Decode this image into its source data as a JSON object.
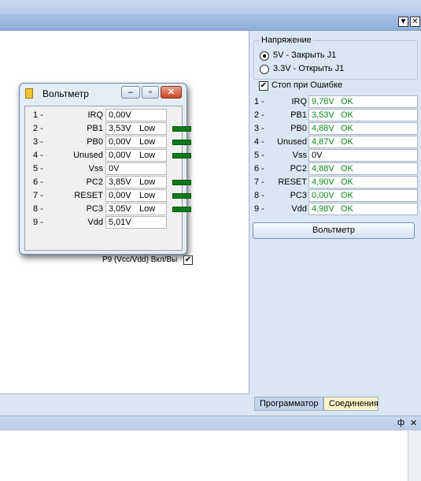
{
  "window": {
    "title_buttons": [
      "▼",
      "✕"
    ]
  },
  "voltmeter_window": {
    "title": "Вольтметр",
    "rows": [
      {
        "num": "1 -",
        "name": "IRQ",
        "value": "0,00V",
        "status": "",
        "led": false
      },
      {
        "num": "2 -",
        "name": "PB1",
        "value": "3,53V",
        "status": "Low",
        "led": true
      },
      {
        "num": "3 -",
        "name": "PB0",
        "value": "0,00V",
        "status": "Low",
        "led": true
      },
      {
        "num": "4 -",
        "name": "Unused",
        "value": "0,00V",
        "status": "Low",
        "led": true
      },
      {
        "num": "5 -",
        "name": "Vss",
        "value": "0V",
        "status": "",
        "led": false
      },
      {
        "num": "6 -",
        "name": "PC2",
        "value": "3,85V",
        "status": "Low",
        "led": true
      },
      {
        "num": "7 -",
        "name": "RESET",
        "value": "0,00V",
        "status": "Low",
        "led": true
      },
      {
        "num": "8 -",
        "name": "PC3",
        "value": "3,05V",
        "status": "Low",
        "led": true
      },
      {
        "num": "9 -",
        "name": "Vdd",
        "value": "5,01V",
        "status": "",
        "led": false
      }
    ],
    "footer_label": "P9 (Vcc/Vdd) Вкл/Вы",
    "footer_checked": true
  },
  "right_panel": {
    "voltage_group_title": "Напряжение",
    "options": [
      {
        "label": "5V - Закрыть J1",
        "selected": true
      },
      {
        "label": "3.3V - Открыть J1",
        "selected": false
      }
    ],
    "stop_on_error_label": "Стоп при Ошибке",
    "stop_on_error_checked": true,
    "rows": [
      {
        "num": "1 -",
        "name": "IRQ",
        "value": "9,78V",
        "status": "OK"
      },
      {
        "num": "2 -",
        "name": "PB1",
        "value": "3,53V",
        "status": "OK"
      },
      {
        "num": "3 -",
        "name": "PB0",
        "value": "4,88V",
        "status": "OK"
      },
      {
        "num": "4 -",
        "name": "Unused",
        "value": "4,87V",
        "status": "OK"
      },
      {
        "num": "5 -",
        "name": "Vss",
        "value": "0V",
        "status": ""
      },
      {
        "num": "6 -",
        "name": "PC2",
        "value": "4,88V",
        "status": "OK"
      },
      {
        "num": "7 -",
        "name": "RESET",
        "value": "4,90V",
        "status": "OK"
      },
      {
        "num": "8 -",
        "name": "PC3",
        "value": "0,00V",
        "status": "OK"
      },
      {
        "num": "9 -",
        "name": "Vdd",
        "value": "4,98V",
        "status": "OK"
      }
    ],
    "voltmeter_button_label": "Вольтметр"
  },
  "tabs": [
    "Программатор",
    "Соединения"
  ],
  "bottom_panel": {
    "buttons": [
      "ф",
      "✕"
    ]
  },
  "colors": {
    "ok": "#0b8a1c",
    "led": "#0f7a1a"
  }
}
